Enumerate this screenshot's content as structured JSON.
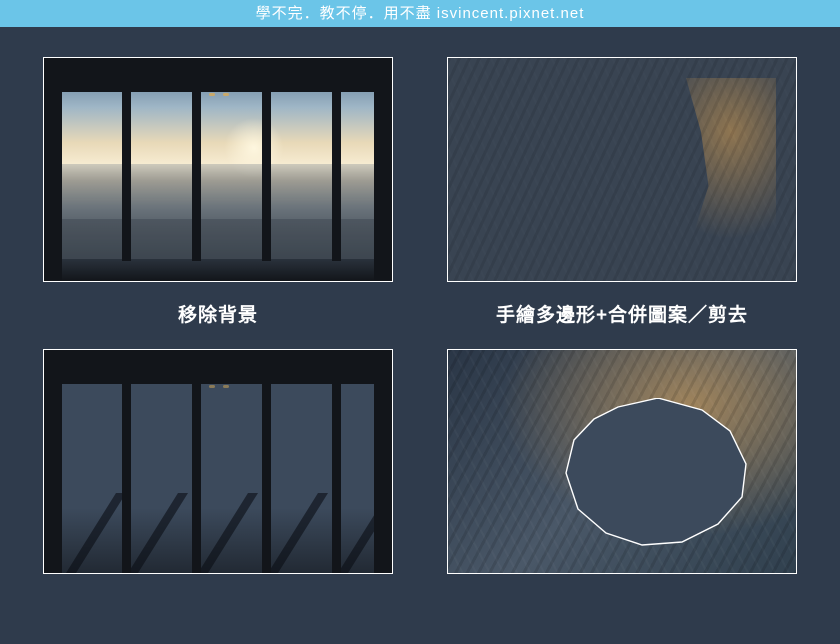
{
  "banner": {
    "text": "學不完．教不停．用不盡 isvincent.pixnet.net"
  },
  "panels": {
    "top_left": {
      "caption": "移除背景",
      "name": "window-cityscape-original"
    },
    "top_right": {
      "caption": "手繪多邊形+合併圖案／剪去",
      "name": "cave-lake-original"
    },
    "bottom_left": {
      "name": "window-frame-bg-removed"
    },
    "bottom_right": {
      "name": "cave-polygon-cutout"
    }
  },
  "colors": {
    "page_bg": "#2f3b4c",
    "banner_bg": "#6bc5e8",
    "text": "#ffffff",
    "removed_bg_fill": "#3c4a5c"
  }
}
